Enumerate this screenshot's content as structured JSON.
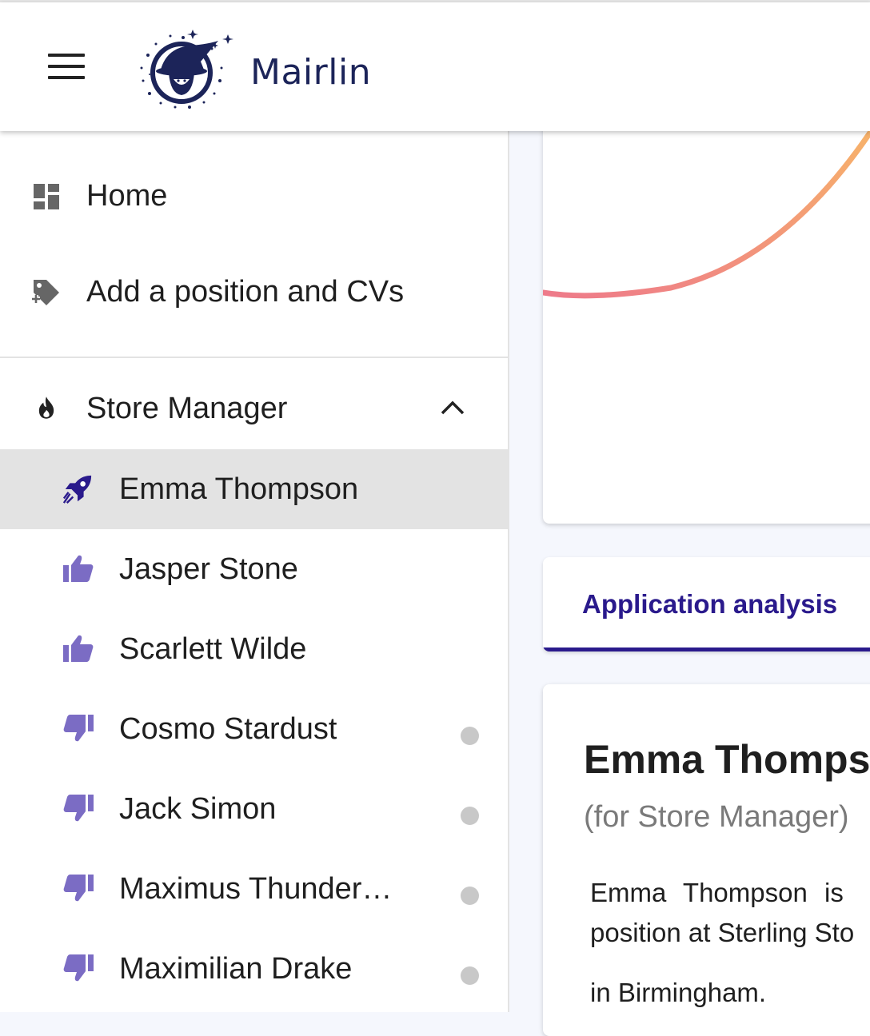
{
  "app": {
    "brand": "Mairlin"
  },
  "sidebar": {
    "nav": [
      {
        "label": "Home",
        "icon": "dashboard-icon"
      },
      {
        "label": "Add a position and CVs",
        "icon": "tag-plus-icon"
      }
    ],
    "position": {
      "label": "Store Manager",
      "icon": "fire-icon",
      "expanded": true
    },
    "candidates": [
      {
        "name": "Emma Thompson",
        "icon": "rocket-icon",
        "selected": true,
        "unread": false
      },
      {
        "name": "Jasper Stone",
        "icon": "thumbs-up-icon",
        "selected": false,
        "unread": false
      },
      {
        "name": "Scarlett Wilde",
        "icon": "thumbs-up-icon",
        "selected": false,
        "unread": false
      },
      {
        "name": "Cosmo Stardust",
        "icon": "thumbs-down-icon",
        "selected": false,
        "unread": true
      },
      {
        "name": "Jack Simon",
        "icon": "thumbs-down-icon",
        "selected": false,
        "unread": true
      },
      {
        "name": "Maximus Thunder…",
        "icon": "thumbs-down-icon",
        "selected": false,
        "unread": true
      },
      {
        "name": "Maximilian Drake",
        "icon": "thumbs-down-icon",
        "selected": false,
        "unread": true
      }
    ]
  },
  "main": {
    "tab": {
      "label": "Application analysis"
    },
    "candidate": {
      "name": "Emma Thomps",
      "subtitle": "(for Store Manager)",
      "summary_line1": "Emma Thompson is",
      "summary_line2": "position at Sterling Sto",
      "summary_line3": "in Birmingham."
    }
  },
  "colors": {
    "accent": "#2a1a8c",
    "icon_purple": "#7b6cc4",
    "brand_navy": "#1c2459",
    "selected_bg": "#e3e3e3",
    "arc_start": "#ee7a8a",
    "arc_end": "#f7b26a"
  }
}
